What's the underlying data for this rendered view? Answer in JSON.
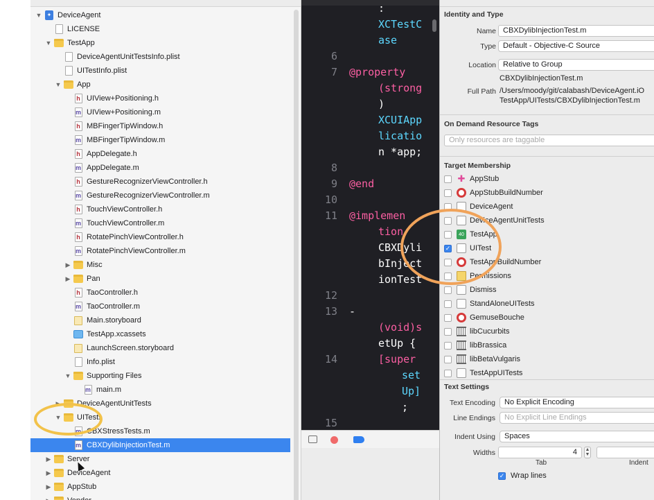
{
  "navigator": {
    "items": [
      {
        "label": "DeviceAgent",
        "indent": 0,
        "disclosure": "open",
        "icon": "project-icon"
      },
      {
        "label": "LICENSE",
        "indent": 1,
        "disclosure": "",
        "icon": "plain-file-icon"
      },
      {
        "label": "TestApp",
        "indent": 1,
        "disclosure": "open",
        "icon": "folder-icon"
      },
      {
        "label": "DeviceAgentUnitTestsInfo.plist",
        "indent": 2,
        "disclosure": "",
        "icon": "plist-file-icon"
      },
      {
        "label": "UITestInfo.plist",
        "indent": 2,
        "disclosure": "",
        "icon": "plist-file-icon"
      },
      {
        "label": "App",
        "indent": 2,
        "disclosure": "open",
        "icon": "folder-icon"
      },
      {
        "label": "UIView+Positioning.h",
        "indent": 3,
        "disclosure": "",
        "icon": "header-file-icon"
      },
      {
        "label": "UIView+Positioning.m",
        "indent": 3,
        "disclosure": "",
        "icon": "objc-file-icon"
      },
      {
        "label": "MBFingerTipWindow.h",
        "indent": 3,
        "disclosure": "",
        "icon": "header-file-icon"
      },
      {
        "label": "MBFingerTipWindow.m",
        "indent": 3,
        "disclosure": "",
        "icon": "objc-file-icon"
      },
      {
        "label": "AppDelegate.h",
        "indent": 3,
        "disclosure": "",
        "icon": "header-file-icon"
      },
      {
        "label": "AppDelegate.m",
        "indent": 3,
        "disclosure": "",
        "icon": "objc-file-icon"
      },
      {
        "label": "GestureRecognizerViewController.h",
        "indent": 3,
        "disclosure": "",
        "icon": "header-file-icon"
      },
      {
        "label": "GestureRecognizerViewController.m",
        "indent": 3,
        "disclosure": "",
        "icon": "objc-file-icon"
      },
      {
        "label": "TouchViewController.h",
        "indent": 3,
        "disclosure": "",
        "icon": "header-file-icon"
      },
      {
        "label": "TouchViewController.m",
        "indent": 3,
        "disclosure": "",
        "icon": "objc-file-icon"
      },
      {
        "label": "RotatePinchViewController.h",
        "indent": 3,
        "disclosure": "",
        "icon": "header-file-icon"
      },
      {
        "label": "RotatePinchViewController.m",
        "indent": 3,
        "disclosure": "",
        "icon": "objc-file-icon"
      },
      {
        "label": "Misc",
        "indent": 3,
        "disclosure": "closed",
        "icon": "folder-icon"
      },
      {
        "label": "Pan",
        "indent": 3,
        "disclosure": "closed",
        "icon": "folder-icon"
      },
      {
        "label": "TaoController.h",
        "indent": 3,
        "disclosure": "",
        "icon": "header-file-icon"
      },
      {
        "label": "TaoController.m",
        "indent": 3,
        "disclosure": "",
        "icon": "objc-file-icon"
      },
      {
        "label": "Main.storyboard",
        "indent": 3,
        "disclosure": "",
        "icon": "storyboard-icon"
      },
      {
        "label": "TestApp.xcassets",
        "indent": 3,
        "disclosure": "",
        "icon": "asset-catalog-icon"
      },
      {
        "label": "LaunchScreen.storyboard",
        "indent": 3,
        "disclosure": "",
        "icon": "storyboard-icon"
      },
      {
        "label": "Info.plist",
        "indent": 3,
        "disclosure": "",
        "icon": "plist-file-icon"
      },
      {
        "label": "Supporting Files",
        "indent": 3,
        "disclosure": "open",
        "icon": "folder-icon"
      },
      {
        "label": "main.m",
        "indent": 4,
        "disclosure": "",
        "icon": "objc-file-icon"
      },
      {
        "label": "DeviceAgentUnitTests",
        "indent": 2,
        "disclosure": "closed",
        "icon": "folder-icon"
      },
      {
        "label": "UITests",
        "indent": 2,
        "disclosure": "open",
        "icon": "folder-icon"
      },
      {
        "label": "CBXStressTests.m",
        "indent": 3,
        "disclosure": "",
        "icon": "objc-file-icon"
      },
      {
        "label": "CBXDylibInjectionTest.m",
        "indent": 3,
        "disclosure": "",
        "icon": "objc-file-icon",
        "selected": true
      },
      {
        "label": "Server",
        "indent": 1,
        "disclosure": "closed",
        "icon": "folder-icon"
      },
      {
        "label": "DeviceAgent",
        "indent": 1,
        "disclosure": "closed",
        "icon": "folder-icon"
      },
      {
        "label": "AppStub",
        "indent": 1,
        "disclosure": "closed",
        "icon": "folder-icon"
      },
      {
        "label": "Vendor",
        "indent": 1,
        "disclosure": "closed",
        "icon": "folder-icon"
      }
    ]
  },
  "editor": {
    "line_numbers": [
      "6",
      "7",
      "8",
      "9",
      "10",
      "11",
      "12",
      "13",
      "14",
      "15"
    ],
    "code": [
      {
        "text": ":",
        "kind": "pln"
      },
      {
        "text": "XCTestC",
        "kind": "cls"
      },
      {
        "text": "ase",
        "kind": "cls"
      },
      {
        "text": "@property",
        "kind": "kw"
      },
      {
        "text": "(strong",
        "kind": "kw"
      },
      {
        "text": ")",
        "kind": "pln"
      },
      {
        "text": "XCUIApp",
        "kind": "cls"
      },
      {
        "text": "licatio",
        "kind": "cls"
      },
      {
        "text": "n *app;",
        "kind": "mixed"
      },
      {
        "text": "@end",
        "kind": "kw"
      },
      {
        "text": "@implemen",
        "kind": "kw"
      },
      {
        "text": "tion",
        "kind": "kw"
      },
      {
        "text": "CBXDyli",
        "kind": "pln"
      },
      {
        "text": "bInject",
        "kind": "pln"
      },
      {
        "text": "ionTest",
        "kind": "pln"
      },
      {
        "text": "-",
        "kind": "pln"
      },
      {
        "text": "(void)s",
        "kind": "mixed2"
      },
      {
        "text": "etUp {",
        "kind": "pln"
      },
      {
        "text": "[super",
        "kind": "kw"
      },
      {
        "text": "set",
        "kind": "cls"
      },
      {
        "text": "Up]",
        "kind": "cls"
      },
      {
        "text": ";",
        "kind": "pln"
      }
    ]
  },
  "inspector": {
    "identity": {
      "header": "Identity and Type",
      "name_label": "Name",
      "name_value": "CBXDylibInjectionTest.m",
      "type_label": "Type",
      "type_value": "Default - Objective-C Source",
      "location_label": "Location",
      "location_value": "Relative to Group",
      "file_name": "CBXDylibInjectionTest.m",
      "full_path_label": "Full Path",
      "full_path_line1": "/Users/moody/git/calabash/DeviceAgent.iO",
      "full_path_line2": "TestApp/UITests/CBXDylibInjectionTest.m"
    },
    "on_demand": {
      "header": "On Demand Resource Tags",
      "placeholder": "Only resources are taggable"
    },
    "target_membership": {
      "header": "Target Membership",
      "targets": [
        {
          "label": "AppStub",
          "checked": false,
          "icon": "app-icon"
        },
        {
          "label": "AppStubBuildNumber",
          "checked": false,
          "icon": "bundle-target-icon"
        },
        {
          "label": "DeviceAgent",
          "checked": false,
          "icon": "test-bundle-icon"
        },
        {
          "label": "DeviceAgentUnitTests",
          "checked": false,
          "icon": "test-bundle-icon"
        },
        {
          "label": "TestApp",
          "checked": false,
          "icon": "app-icon-green"
        },
        {
          "label": "UITest",
          "checked": true,
          "icon": "test-bundle-icon"
        },
        {
          "label": "TestAppBuildNumber",
          "checked": false,
          "icon": "bundle-target-icon"
        },
        {
          "label": "Permissions",
          "checked": false,
          "icon": "permissions-icon"
        },
        {
          "label": "Dismiss",
          "checked": false,
          "icon": "test-bundle-icon"
        },
        {
          "label": "StandAloneUITests",
          "checked": false,
          "icon": "test-bundle-icon"
        },
        {
          "label": "GemuseBouche",
          "checked": false,
          "icon": "bundle-target-icon"
        },
        {
          "label": "libCucurbits",
          "checked": false,
          "icon": "library-icon"
        },
        {
          "label": "libBrassica",
          "checked": false,
          "icon": "library-icon"
        },
        {
          "label": "libBetaVulgaris",
          "checked": false,
          "icon": "library-icon"
        },
        {
          "label": "TestAppUITests",
          "checked": false,
          "icon": "test-bundle-icon"
        }
      ]
    },
    "text_settings": {
      "header": "Text Settings",
      "encoding_label": "Text Encoding",
      "encoding_value": "No Explicit Encoding",
      "line_endings_label": "Line Endings",
      "line_endings_value": "No Explicit Line Endings",
      "indent_using_label": "Indent Using",
      "indent_using_value": "Spaces",
      "widths_label": "Widths",
      "tab_width": "4",
      "tab_caption": "Tab",
      "indent_caption": "Indent",
      "wrap_lines_label": "Wrap lines",
      "wrap_lines_checked": true
    }
  },
  "colors": {
    "selection": "#3b86ee",
    "highlight_ring": "#f0a35a",
    "highlight_ring_nav": "#f2c24a",
    "editor_bg": "#1f1f24"
  }
}
